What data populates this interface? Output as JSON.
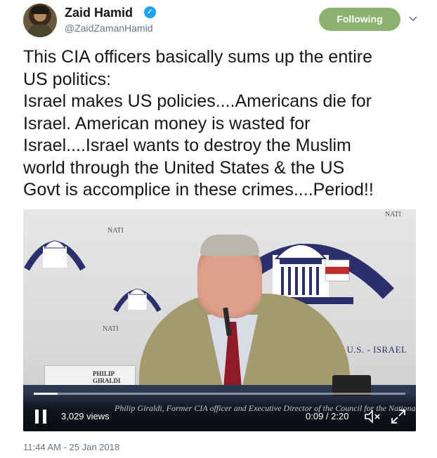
{
  "author": {
    "name": "Zaid Hamid",
    "handle": "@ZaidZamanHamid",
    "verified": true
  },
  "follow_button": {
    "label": "Following",
    "color": "#8bb16f"
  },
  "tweet": {
    "lines": [
      "This CIA officers basically sums up the entire",
      "US politics:",
      "Israel makes US policies....Americans die for",
      "Israel. American money is wasted for",
      "Israel....Israel wants to destroy the Muslim",
      "world through the United States & the US",
      "Govt is accomplice in these crimes....Period!!"
    ],
    "timestamp": "11:44 AM - 25 Jan 2018"
  },
  "video": {
    "views": "3,029 views",
    "current_time": "0:09",
    "duration": "2:20",
    "time_display": "0:09 / 2:20",
    "progress_fraction": 0.064,
    "caption": "Philip Giraldi, Former CIA officer and Executive Director of the Council for the National Interest",
    "nametag": "PHILIP GIRALDI",
    "banner_text": "THE U.S. - ISRAEL",
    "nat_text": "NATI"
  },
  "icons": {
    "verified": "verified-badge-icon",
    "chevron": "chevron-down-icon",
    "pause": "pause-icon",
    "mute": "volume-muted-icon",
    "expand": "fullscreen-icon"
  },
  "colors": {
    "accent_blue": "#1da1f2",
    "secondary_text": "#657786"
  }
}
